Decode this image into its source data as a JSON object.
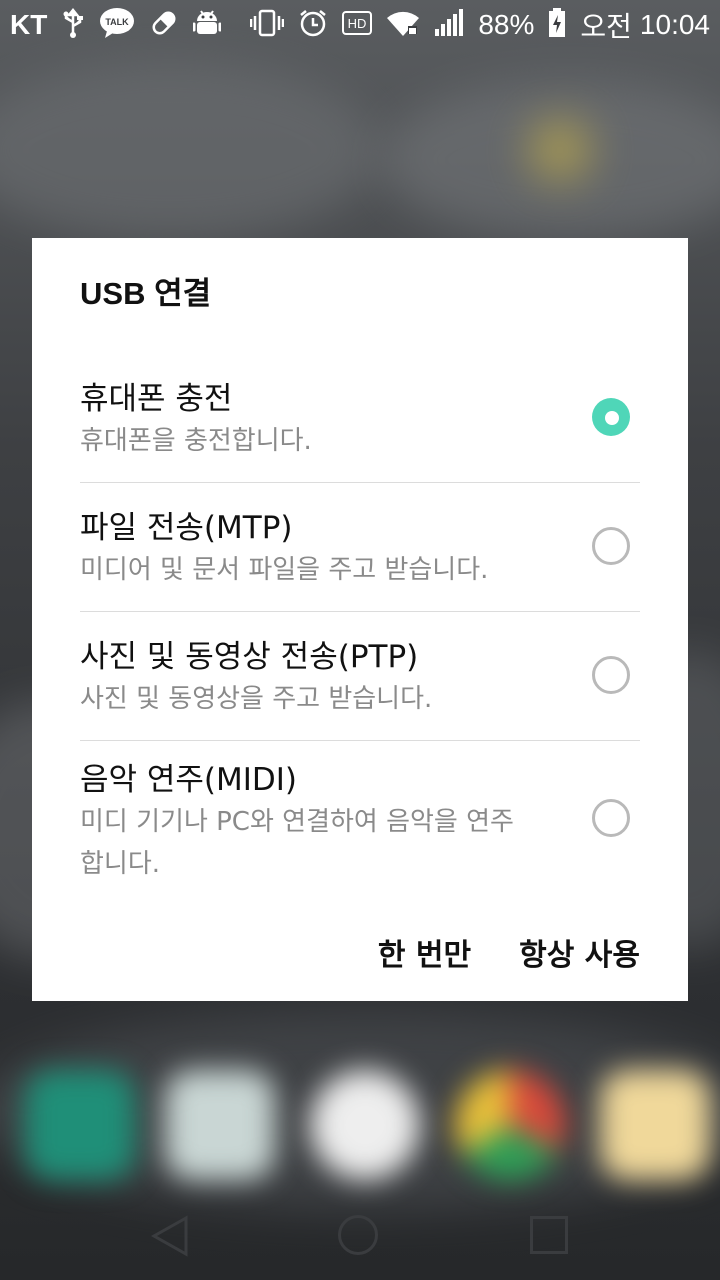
{
  "status_bar": {
    "carrier": "KT",
    "icons_left": [
      "usb-icon",
      "talk-icon",
      "pill-icon",
      "android-icon"
    ],
    "talk_icon_text": "TALK",
    "icons_right": [
      "vibrate-icon",
      "alarm-icon",
      "hd-icon",
      "wifi-icon",
      "signal-icon",
      "battery-icon"
    ],
    "hd_icon_text": "HD",
    "battery": "88%",
    "ampm": "오전",
    "time": "10:04"
  },
  "dialog": {
    "title": "USB 연결",
    "options": [
      {
        "title": "휴대폰 충전",
        "description": "휴대폰을 충전합니다.",
        "selected": true
      },
      {
        "title": "파일 전송(MTP)",
        "description": "미디어 및 문서 파일을 주고 받습니다.",
        "selected": false
      },
      {
        "title": "사진 및 동영상 전송(PTP)",
        "description": "사진 및 동영상을 주고 받습니다.",
        "selected": false
      },
      {
        "title": "음악 연주(MIDI)",
        "description": "미디 기기나 PC와 연결하여 음악을 연주합니다.",
        "selected": false
      }
    ],
    "buttons": {
      "just_once": "한 번만",
      "always": "항상 사용"
    },
    "accent_color": "#4fd6b8"
  },
  "nav_bar": {
    "icons": [
      "back-icon",
      "home-icon",
      "recent-apps-icon"
    ]
  }
}
